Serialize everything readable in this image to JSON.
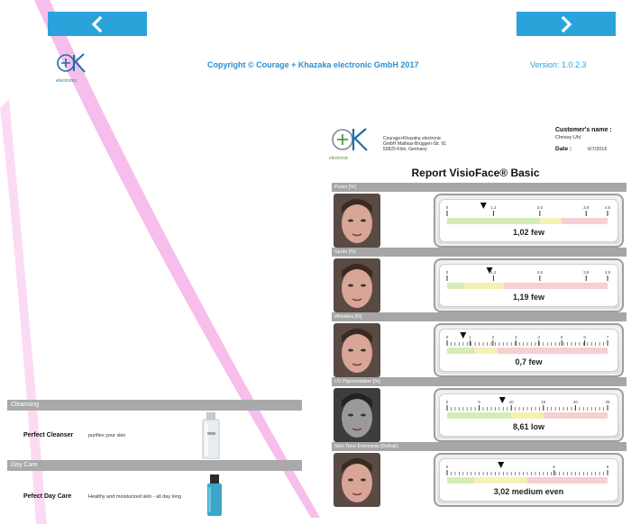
{
  "nav": {
    "back_icon": "chevron-left-icon",
    "next_icon": "chevron-right-icon",
    "accent": "#2aa3db"
  },
  "brand": {
    "logo_text": "electronic",
    "copyright": "Copyright © Courage + Khazaka electronic GmbH 2017",
    "version": "Version: 1.0.2.3"
  },
  "products": {
    "categories": [
      {
        "label": "Cleansing",
        "name": "Perfect Cleanser",
        "description": "purifies your skin"
      },
      {
        "label": "Day Care",
        "name": "Pefect Day Care",
        "description": "Healthy and moisturized skin - all day long"
      }
    ]
  },
  "report": {
    "address_line1": "Courage+Khazaka electronic",
    "address_line2": "GmbH  Mathias-Brüggen-Str. 91",
    "address_line3": "50829 Köln, Germany",
    "logo_text": "electronic",
    "customer_label": "Customer's name :",
    "customer_name": "Chrissy Uhl",
    "date_label": "Date :",
    "date_value": "6/7/2016",
    "title": "Report VisioFace® Basic",
    "sections": [
      {
        "label": "Pores [%]",
        "value_text": "1,02 few",
        "value": 1.02,
        "ticks": [
          "0",
          "1,3",
          "2,6",
          "3,9",
          "4,5"
        ],
        "tick_values": [
          0,
          1.3,
          2.6,
          3.9,
          4.5
        ],
        "range": [
          0,
          4.5
        ],
        "zones": [
          {
            "from": 0,
            "to": 2.6,
            "color": "#d6ecb8"
          },
          {
            "from": 2.6,
            "to": 3.2,
            "color": "#f4f1b4"
          },
          {
            "from": 3.2,
            "to": 4.5,
            "color": "#f8cfd2"
          }
        ],
        "minor_ticks": false
      },
      {
        "label": "Spots [%]",
        "value_text": "1,19 few",
        "value": 1.19,
        "ticks": [
          "0",
          "1,3",
          "2,6",
          "3,9",
          "4,5"
        ],
        "tick_values": [
          0,
          1.3,
          2.6,
          3.9,
          4.5
        ],
        "range": [
          0,
          4.5
        ],
        "zones": [
          {
            "from": 0,
            "to": 0.5,
            "color": "#d6ecb8"
          },
          {
            "from": 0.5,
            "to": 1.6,
            "color": "#f4f1b4"
          },
          {
            "from": 1.6,
            "to": 4.5,
            "color": "#f8cfd2"
          }
        ],
        "minor_ticks": false
      },
      {
        "label": "Wrinkles [%]",
        "value_text": "0,7 few",
        "value": 0.7,
        "ticks": [
          "0",
          "1",
          "2",
          "3",
          "4",
          "5",
          "6",
          "7"
        ],
        "tick_values": [
          0,
          1,
          2,
          3,
          4,
          5,
          6,
          7
        ],
        "range": [
          0,
          7
        ],
        "zones": [
          {
            "from": 0,
            "to": 1.2,
            "color": "#d6ecb8"
          },
          {
            "from": 1.2,
            "to": 2.2,
            "color": "#f4f1b4"
          },
          {
            "from": 2.2,
            "to": 7,
            "color": "#f8cfd2"
          }
        ],
        "minor_ticks": true
      },
      {
        "label": "UV Pigmentation [%]",
        "value_text": "8,61 low",
        "value": 8.61,
        "ticks": [
          "0",
          "5",
          "10",
          "15",
          "20",
          "25"
        ],
        "tick_values": [
          0,
          5,
          10,
          15,
          20,
          25
        ],
        "range": [
          0,
          25
        ],
        "zones": [
          {
            "from": 0,
            "to": 10,
            "color": "#d6ecb8"
          },
          {
            "from": 10,
            "to": 15,
            "color": "#f4f1b4"
          },
          {
            "from": 15,
            "to": 25,
            "color": "#f8cfd2"
          }
        ],
        "minor_ticks": true
      },
      {
        "label": "Skin Tone Evenness [DeltaE]",
        "value_text": "3,02 medium even",
        "value": 3.02,
        "ticks": [
          "0",
          "6",
          "9"
        ],
        "tick_values": [
          0,
          6,
          9
        ],
        "range": [
          0,
          9
        ],
        "zones": [
          {
            "from": 0,
            "to": 1.5,
            "color": "#d6ecb8"
          },
          {
            "from": 1.5,
            "to": 4.5,
            "color": "#f4f1b4"
          },
          {
            "from": 4.5,
            "to": 9,
            "color": "#f8cfd2"
          }
        ],
        "minor_ticks": true
      }
    ]
  }
}
